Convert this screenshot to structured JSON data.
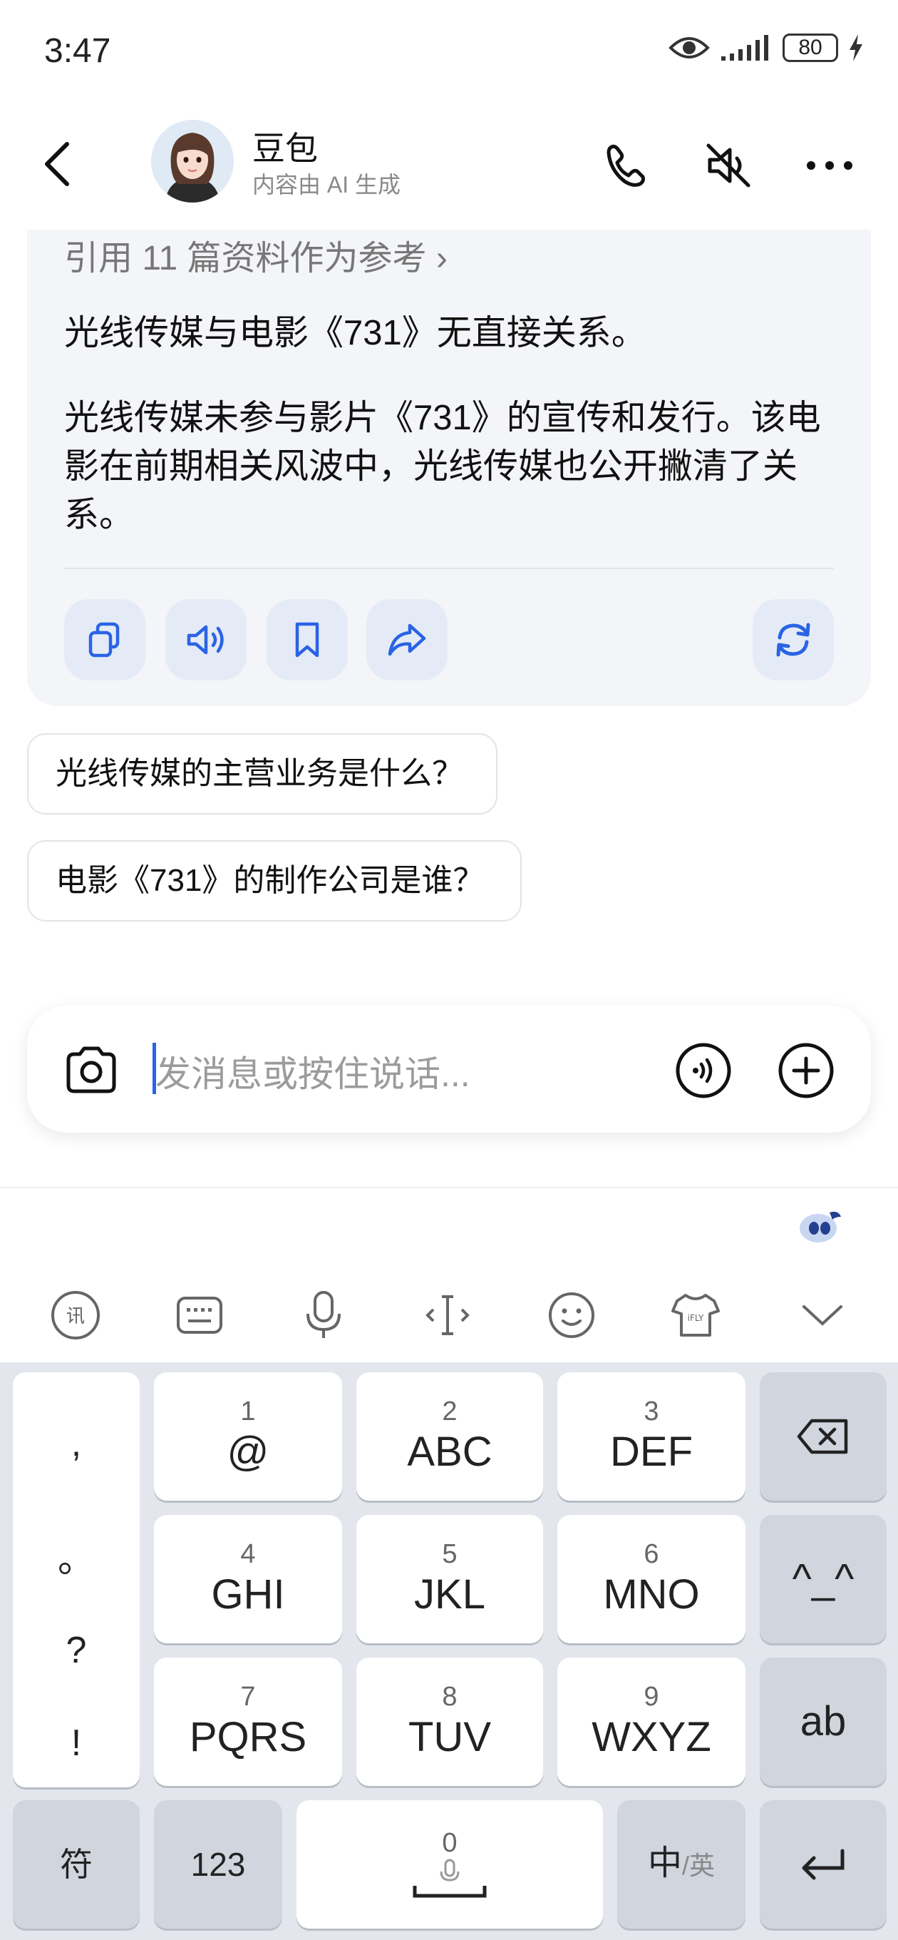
{
  "status_bar": {
    "time": "3:47",
    "battery": "80"
  },
  "header": {
    "title": "豆包",
    "subtitle": "内容由 AI 生成"
  },
  "answer": {
    "references": "引用 11 篇资料作为参考 ›",
    "paragraph1": "光线传媒与电影《731》无直接关系。",
    "paragraph2": "光线传媒未参与影片《731》的宣传和发行。该电影在前期相关风波中，光线传媒也公开撇清了关系。"
  },
  "suggestions": [
    "光线传媒的主营业务是什么？",
    "电影《731》的制作公司是谁？"
  ],
  "input": {
    "placeholder": "发消息或按住说话..."
  },
  "keyboard": {
    "punct": [
      ",",
      "。",
      "?",
      "!"
    ],
    "keys": [
      {
        "num": "1",
        "label": "@"
      },
      {
        "num": "2",
        "label": "ABC"
      },
      {
        "num": "3",
        "label": "DEF"
      },
      {
        "num": "4",
        "label": "GHI"
      },
      {
        "num": "5",
        "label": "JKL"
      },
      {
        "num": "6",
        "label": "MNO"
      },
      {
        "num": "7",
        "label": "PQRS"
      },
      {
        "num": "8",
        "label": "TUV"
      },
      {
        "num": "9",
        "label": "WXYZ"
      }
    ],
    "emoticon": "^_^",
    "ab": "ab",
    "symbols": "符",
    "numbers": "123",
    "space_num": "0",
    "lang_main": "中",
    "lang_alt": "/英"
  },
  "colors": {
    "accent": "#2a63e5",
    "card_bg": "#f4f5f8",
    "action_bg": "#e5ebf6",
    "keyboard_bg": "#e3e6ec"
  }
}
